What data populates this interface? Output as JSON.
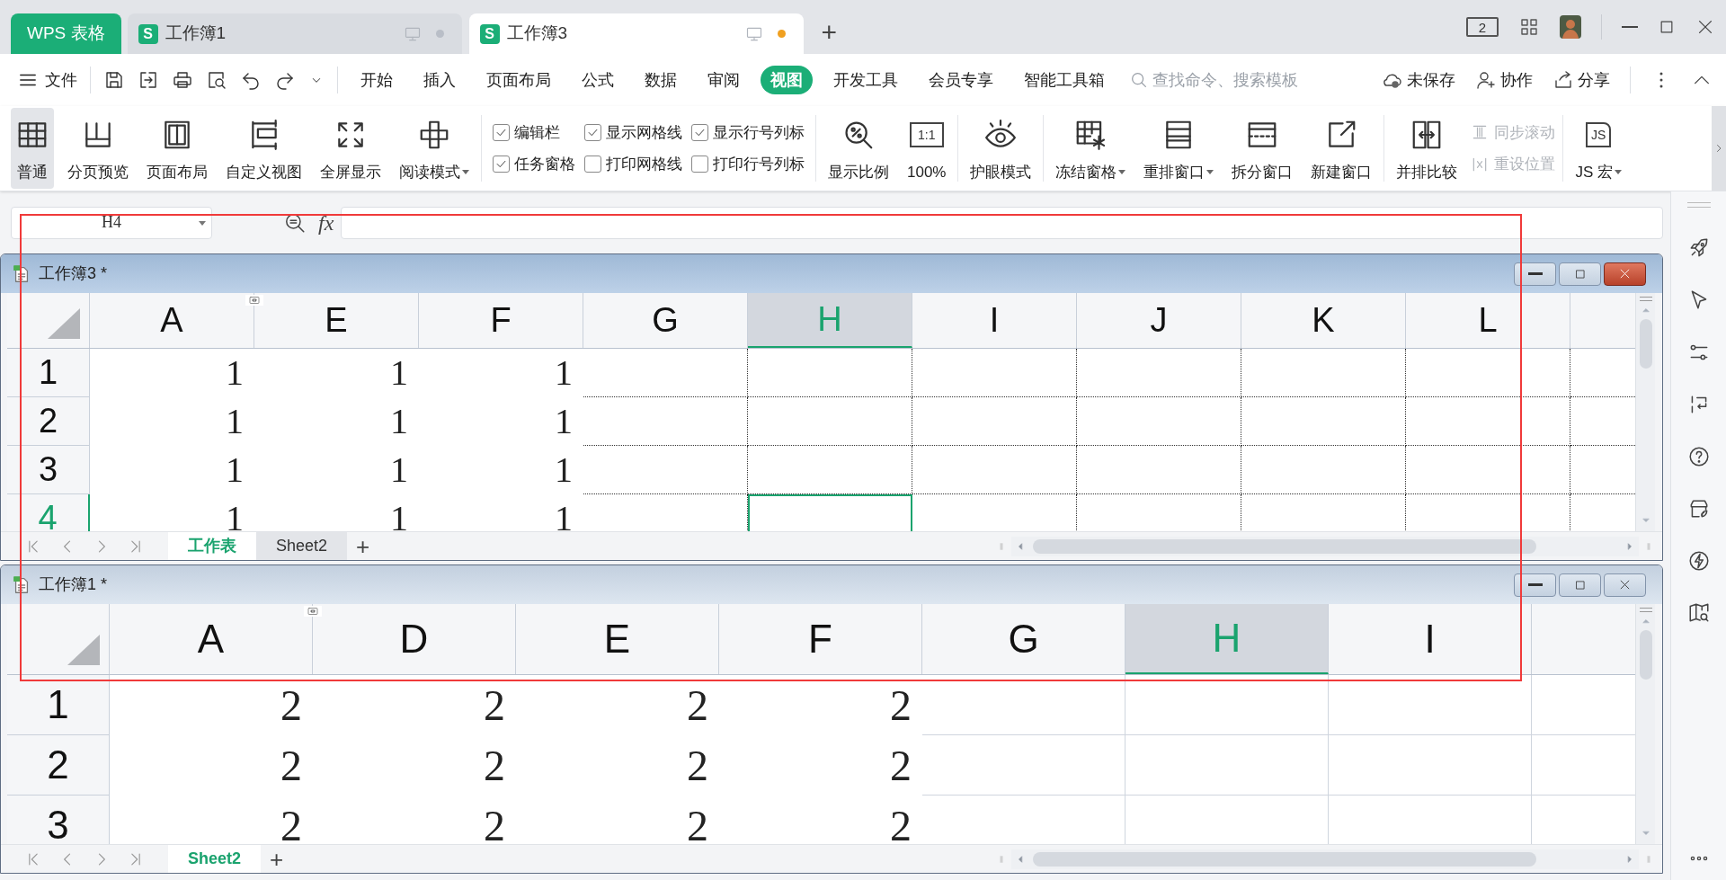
{
  "app_tabs": [
    {
      "kind": "home",
      "label": "WPS 表格"
    },
    {
      "kind": "document",
      "logo": "S",
      "label": "工作簿1",
      "selected": false,
      "modified": false
    },
    {
      "kind": "document",
      "logo": "S",
      "label": "工作簿3",
      "selected": true,
      "modified": true
    }
  ],
  "new_tab": "+",
  "title_bar": {
    "screen_count": "2"
  },
  "menu": {
    "file": "文件",
    "tabs": [
      {
        "label": "开始",
        "selected": false
      },
      {
        "label": "插入",
        "selected": false
      },
      {
        "label": "页面布局",
        "selected": false
      },
      {
        "label": "公式",
        "selected": false
      },
      {
        "label": "数据",
        "selected": false
      },
      {
        "label": "审阅",
        "selected": false
      },
      {
        "label": "视图",
        "selected": true
      },
      {
        "label": "开发工具",
        "selected": false
      },
      {
        "label": "会员专享",
        "selected": false
      },
      {
        "label": "智能工具箱",
        "selected": false
      }
    ],
    "search": {
      "placeholder": "查找命令、搜索模板"
    },
    "actions": [
      {
        "label": "未保存"
      },
      {
        "label": "协作"
      },
      {
        "label": "分享"
      }
    ]
  },
  "ribbon": {
    "groups": [
      {
        "items": [
          {
            "kind": "large",
            "label": "普通",
            "selected": true
          },
          {
            "kind": "large",
            "label": "分页预览",
            "selected": false
          },
          {
            "kind": "large",
            "label": "页面布局",
            "selected": false
          },
          {
            "kind": "large",
            "label": "自定义视图",
            "selected": false
          },
          {
            "kind": "large",
            "label": "全屏显示",
            "selected": false
          },
          {
            "kind": "large",
            "label": "阅读模式",
            "selected": false,
            "dropdown": true
          }
        ]
      },
      {
        "items": [
          {
            "kind": "checkbox",
            "label": "编辑栏",
            "checked": true
          },
          {
            "kind": "checkbox",
            "label": "显示网格线",
            "checked": true
          },
          {
            "kind": "checkbox",
            "label": "显示行号列标",
            "checked": true
          },
          {
            "kind": "checkbox",
            "label": "任务窗格",
            "checked": true
          },
          {
            "kind": "checkbox",
            "label": "打印网格线",
            "checked": false
          },
          {
            "kind": "checkbox",
            "label": "打印行号列标",
            "checked": false
          }
        ]
      },
      {
        "items": [
          {
            "kind": "large",
            "label": "显示比例",
            "selected": false
          },
          {
            "kind": "large",
            "label": "100%",
            "selected": false,
            "icon_text": "1:1"
          }
        ]
      },
      {
        "items": [
          {
            "kind": "large",
            "label": "护眼模式",
            "selected": false
          }
        ]
      },
      {
        "items": [
          {
            "kind": "large",
            "label": "冻结窗格",
            "selected": false,
            "dropdown": true
          },
          {
            "kind": "large",
            "label": "重排窗口",
            "selected": false,
            "dropdown": true
          },
          {
            "kind": "large",
            "label": "拆分窗口",
            "selected": false
          },
          {
            "kind": "large",
            "label": "新建窗口",
            "selected": false
          }
        ]
      },
      {
        "items": [
          {
            "kind": "large",
            "label": "并排比较",
            "selected": false
          },
          {
            "kind": "small",
            "label": "同步滚动",
            "disabled": true
          },
          {
            "kind": "small",
            "label": "重设位置",
            "disabled": true
          }
        ]
      },
      {
        "items": [
          {
            "kind": "large",
            "label": "JS 宏",
            "selected": false,
            "dropdown": true,
            "icon_text": "JS"
          }
        ]
      }
    ]
  },
  "formula_bar": {
    "cell_ref": "H4",
    "fx": "fx"
  },
  "windows": [
    {
      "title": "工作簿3 *",
      "active": true,
      "page_breaks": true,
      "columns": [
        {
          "label": "A",
          "selected": false
        },
        {
          "label": "E",
          "selected": false,
          "hidden_before": true
        },
        {
          "label": "F",
          "selected": false
        },
        {
          "label": "G",
          "selected": false
        },
        {
          "label": "H",
          "selected": true
        },
        {
          "label": "I",
          "selected": false
        },
        {
          "label": "J",
          "selected": false
        },
        {
          "label": "K",
          "selected": false
        },
        {
          "label": "L",
          "selected": false
        }
      ],
      "rows": [
        {
          "label": "1",
          "selected": false,
          "cells": [
            "1",
            "1",
            "1"
          ]
        },
        {
          "label": "2",
          "selected": false,
          "cells": [
            "1",
            "1",
            "1"
          ]
        },
        {
          "label": "3",
          "selected": false,
          "cells": [
            "1",
            "1",
            "1"
          ]
        },
        {
          "label": "4",
          "selected": true,
          "cells": [
            "1",
            "1",
            "1"
          ]
        }
      ],
      "sheets": [
        {
          "label": "工作表",
          "selected": true
        },
        {
          "label": "Sheet2",
          "selected": false
        }
      ],
      "add_sheet": "+"
    },
    {
      "title": "工作簿1 *",
      "active": false,
      "page_breaks": false,
      "columns": [
        {
          "label": "A",
          "selected": false
        },
        {
          "label": "D",
          "selected": false,
          "hidden_before": true
        },
        {
          "label": "E",
          "selected": false
        },
        {
          "label": "F",
          "selected": false
        },
        {
          "label": "G",
          "selected": false
        },
        {
          "label": "H",
          "selected": true
        },
        {
          "label": "I",
          "selected": false
        }
      ],
      "rows": [
        {
          "label": "1",
          "selected": false,
          "cells": [
            "2",
            "2",
            "2",
            "2"
          ]
        },
        {
          "label": "2",
          "selected": false,
          "cells": [
            "2",
            "2",
            "2",
            "2"
          ]
        },
        {
          "label": "3",
          "selected": false,
          "cells": [
            "2",
            "2",
            "2",
            "2"
          ]
        }
      ],
      "sheets": [
        {
          "label": "Sheet2",
          "selected": true
        }
      ],
      "add_sheet": "+"
    }
  ]
}
